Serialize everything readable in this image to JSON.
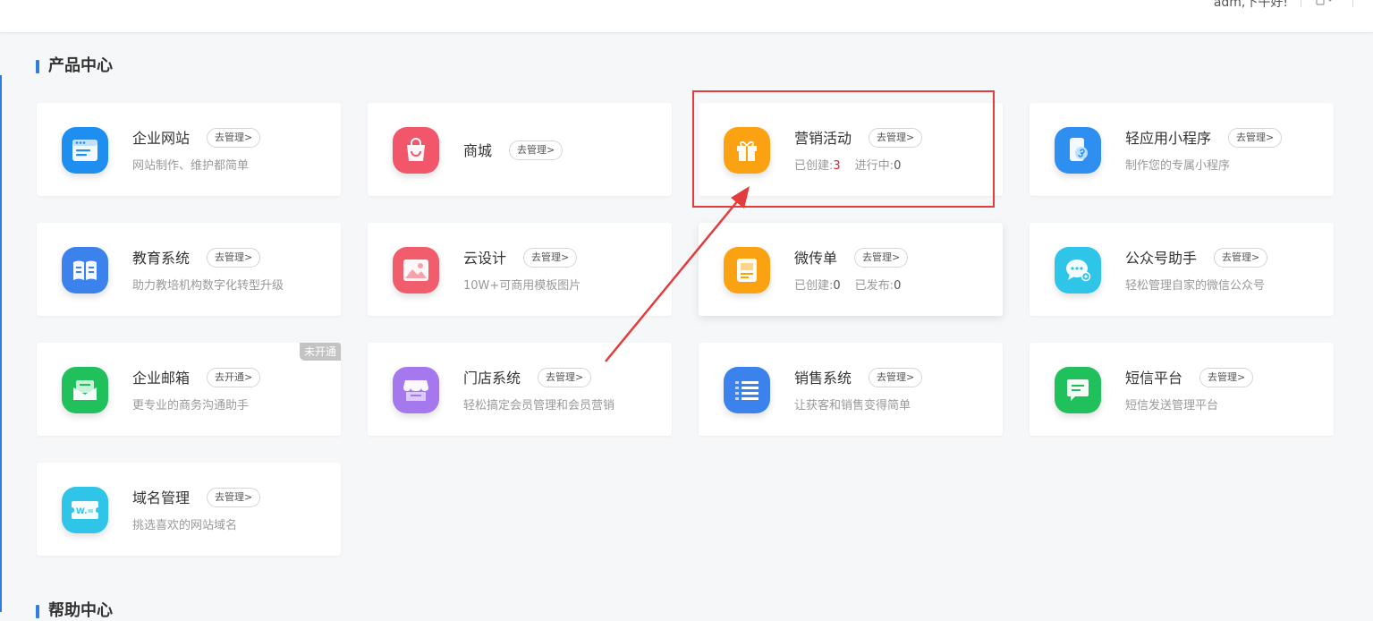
{
  "header": {
    "greeting": "adm,下午好!",
    "icon": "device-icon"
  },
  "product_center": {
    "title": "产品中心",
    "cards": [
      {
        "name": "企业网站",
        "button": "去管理>",
        "desc": "网站制作、维护都简单",
        "icon": "website-icon",
        "color": "#1e8ef0"
      },
      {
        "name": "商城",
        "button": "去管理>",
        "desc": "",
        "icon": "shopping-bag-icon",
        "color": "#f2566b"
      },
      {
        "name": "营销活动",
        "button": "去管理>",
        "stats": [
          {
            "label": "已创建:",
            "value": "3"
          },
          {
            "label": "进行中:",
            "value": "0"
          }
        ],
        "icon": "gift-icon",
        "color": "#fba212"
      },
      {
        "name": "轻应用小程序",
        "button": "去管理>",
        "desc": "制作您的专属小程序",
        "icon": "mini-program-icon",
        "color": "#2f8ff0"
      },
      {
        "name": "教育系统",
        "button": "去管理>",
        "desc": "助力教培机构数字化转型升级",
        "icon": "book-icon",
        "color": "#3c82ec"
      },
      {
        "name": "云设计",
        "button": "去管理>",
        "desc": "10W+可商用模板图片",
        "icon": "image-icon",
        "color": "#f25d6e"
      },
      {
        "name": "微传单",
        "button": "去管理>",
        "stats": [
          {
            "label": "已创建:",
            "value": "0"
          },
          {
            "label": "已发布:",
            "value": "0"
          }
        ],
        "icon": "flyer-icon",
        "color": "#fba212"
      },
      {
        "name": "公众号助手",
        "button": "去管理>",
        "desc": "轻松管理自家的微信公众号",
        "icon": "wechat-icon",
        "color": "#2ec5e8"
      },
      {
        "name": "企业邮箱",
        "button": "去开通>",
        "desc": "更专业的商务沟通助手",
        "icon": "mail-icon",
        "color": "#20c05c",
        "badge": "未开通"
      },
      {
        "name": "门店系统",
        "button": "去管理>",
        "desc": "轻松搞定会员管理和会员营销",
        "icon": "store-icon",
        "color": "#a678ee"
      },
      {
        "name": "销售系统",
        "button": "去管理>",
        "desc": "让获客和销售变得简单",
        "icon": "list-icon",
        "color": "#3c82ec"
      },
      {
        "name": "短信平台",
        "button": "去管理>",
        "desc": "短信发送管理平台",
        "icon": "sms-icon",
        "color": "#20c05c"
      },
      {
        "name": "域名管理",
        "button": "去管理>",
        "desc": "挑选喜欢的网站域名",
        "icon": "domain-icon",
        "color": "#2ec5e8"
      }
    ]
  },
  "help_center": {
    "title": "帮助中心"
  },
  "annotation": {
    "highlight_color": "#e23c3c",
    "target": "营销活动"
  }
}
